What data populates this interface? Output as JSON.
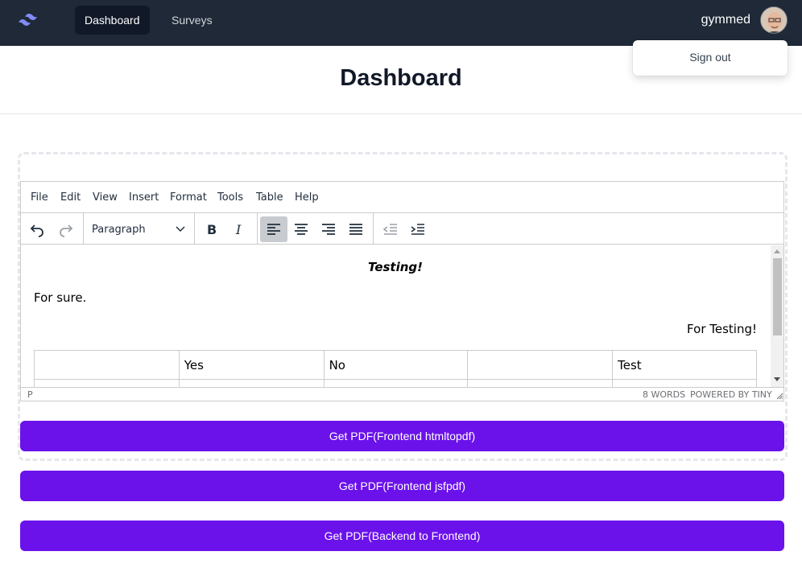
{
  "nav": {
    "dashboard": "Dashboard",
    "surveys": "Surveys",
    "username": "gymmed",
    "signout": "Sign out"
  },
  "header": {
    "title": "Dashboard"
  },
  "editor": {
    "menu": [
      "File",
      "Edit",
      "View",
      "Insert",
      "Format",
      "Tools",
      "Table",
      "Help"
    ],
    "format_select": "Paragraph",
    "content": {
      "heading": "Testing!",
      "line1": "For sure.",
      "line2": "For Testing!",
      "table_row": [
        "",
        "Yes",
        "No",
        "",
        "Test"
      ]
    },
    "status": {
      "path": "P",
      "words": "8 WORDS",
      "powered": "POWERED BY TINY"
    }
  },
  "buttons": {
    "pdf_htmltopdf": "Get PDF(Frontend htmltopdf)",
    "pdf_jsfpdf": "Get PDF(Frontend jsfpdf)",
    "pdf_backend": "Get PDF(Backend to Frontend)"
  },
  "colors": {
    "accent": "#6b12eb",
    "nav_bg": "#1f2937"
  }
}
